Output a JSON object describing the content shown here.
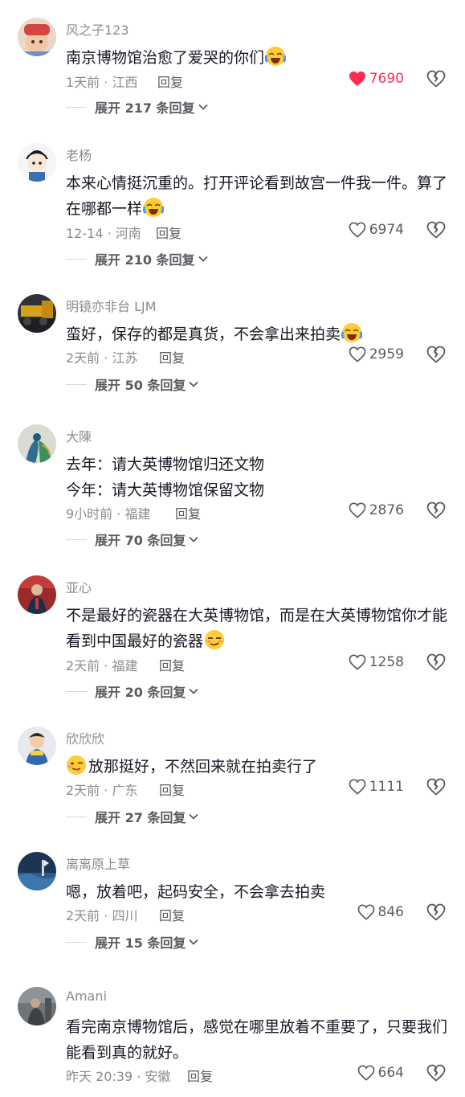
{
  "comments": [
    {
      "username": "风之子123",
      "text": "南京博物馆治愈了爱哭的你们",
      "meta": "1天前 · 江西",
      "reply": "回复",
      "likes": "7690",
      "liked": true,
      "expand": "展开 217 条回复",
      "emoji": "laugh-cry"
    },
    {
      "username": "老杨",
      "text": "本来心情挺沉重的。打开评论看到故宫一件我一件。算了在哪都一样",
      "meta": "12-14 · 河南",
      "reply": "回复",
      "likes": "6974",
      "liked": false,
      "expand": "展开 210 条回复",
      "emoji": "laugh-cry"
    },
    {
      "username": "明镜亦非台 LJM",
      "text": "蛮好，保存的都是真货，不会拿出来拍卖",
      "meta": "2天前 · 江苏",
      "reply": "回复",
      "likes": "2959",
      "liked": false,
      "expand": "展开 50 条回复",
      "emoji": "laugh-cry"
    },
    {
      "username": "大陳",
      "text": "去年：请大英博物馆归还文物",
      "text2": "今年：请大英博物馆保留文物",
      "meta": "9小时前 · 福建",
      "reply": "回复",
      "likes": "2876",
      "liked": false,
      "expand": "展开 70 条回复"
    },
    {
      "username": "亚心",
      "text": "不是最好的瓷器在大英博物馆，而是在大英博物馆你才能看到中国最好的瓷器",
      "meta": "2天前 · 福建",
      "reply": "回复",
      "likes": "1258",
      "liked": false,
      "expand": "展开 20 条回复",
      "emoji": "smirk"
    },
    {
      "username": "欣欣欣",
      "text": "放那挺好，不然回来就在拍卖行了",
      "meta": "2天前 · 广东",
      "reply": "回复",
      "likes": "1111",
      "liked": false,
      "expand": "展开 27 条回复",
      "emoji_prefix": "wink-tongue"
    },
    {
      "username": "离离原上草",
      "text": "嗯，放着吧，起码安全，不会拿去拍卖",
      "meta": "2天前 · 四川",
      "reply": "回复",
      "likes": "846",
      "liked": false,
      "expand": "展开 15 条回复"
    },
    {
      "username": "Amani",
      "text": "看完南京博物馆后，感觉在哪里放着不重要了，只要我们能看到真的就好。",
      "meta": "昨天 20:39 · 安徽",
      "reply": "回复",
      "likes": "664",
      "liked": false
    }
  ],
  "colors": {
    "liked": "#fe2c55",
    "secondary": "#8a8b91",
    "text": "#161823"
  },
  "icons": {
    "like": "heart-icon",
    "dislike": "broken-heart-icon",
    "expand": "chevron-down-icon"
  }
}
